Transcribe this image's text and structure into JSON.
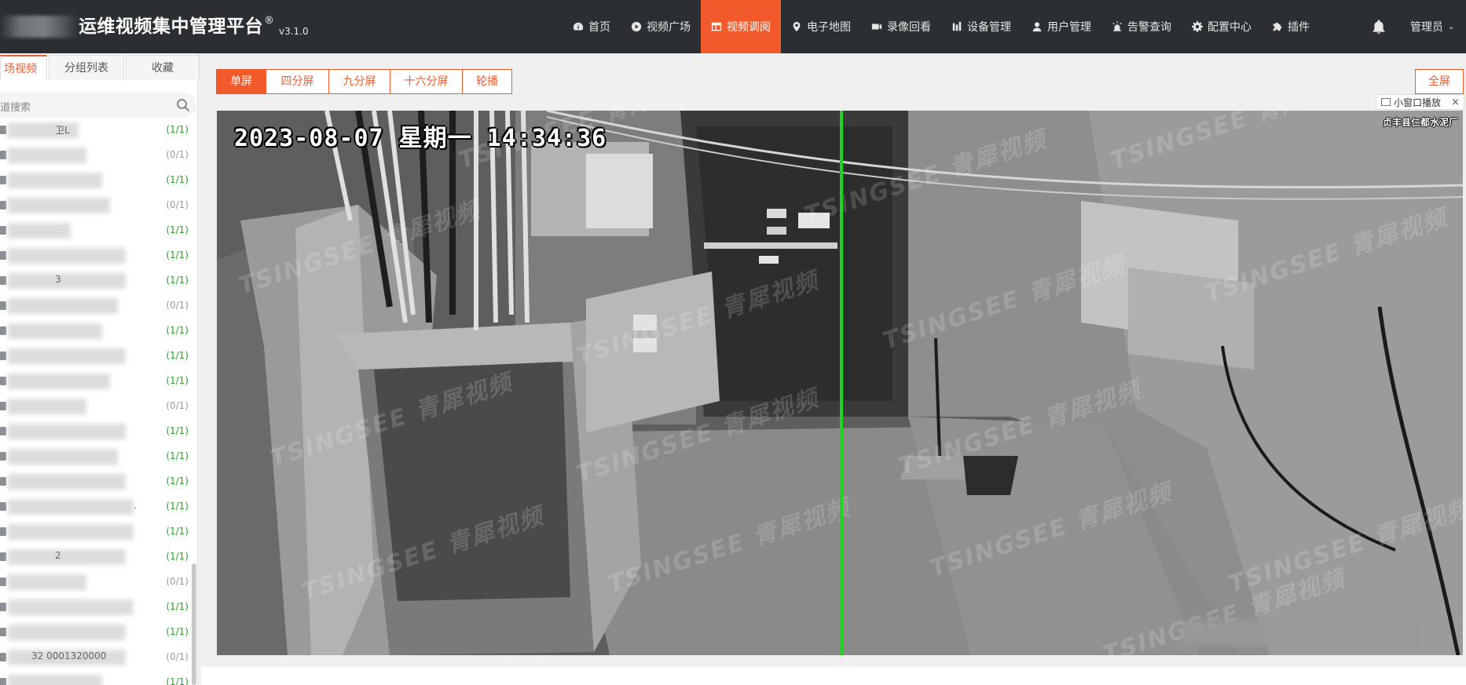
{
  "header": {
    "title": "运维视频集中管理平台",
    "registered": "®",
    "version": "v3.1.0",
    "nav": [
      {
        "label": "首页",
        "icon": "dashboard-icon",
        "active": false
      },
      {
        "label": "视频广场",
        "icon": "play-circle-icon",
        "active": false
      },
      {
        "label": "视频调阅",
        "icon": "grid-table-icon",
        "active": true
      },
      {
        "label": "电子地图",
        "icon": "map-pin-icon",
        "active": false
      },
      {
        "label": "录像回看",
        "icon": "video-camera-icon",
        "active": false
      },
      {
        "label": "设备管理",
        "icon": "device-bars-icon",
        "active": false
      },
      {
        "label": "用户管理",
        "icon": "user-icon",
        "active": false
      },
      {
        "label": "告警查询",
        "icon": "alarm-icon",
        "active": false
      },
      {
        "label": "配置中心",
        "icon": "gear-icon",
        "active": false
      },
      {
        "label": "插件",
        "icon": "puzzle-icon",
        "active": false
      }
    ],
    "notification_icon": "bell-icon",
    "user_label": "管理员"
  },
  "sidebar": {
    "tabs": [
      {
        "label": "场视频",
        "active": true
      },
      {
        "label": "分组列表",
        "active": false
      },
      {
        "label": "收藏",
        "active": false
      }
    ],
    "search_placeholder": "道搜索",
    "items": [
      {
        "fragment": "卫L",
        "count": "(1/1)",
        "online": true
      },
      {
        "fragment": "",
        "count": "(0/1)",
        "online": false
      },
      {
        "fragment": "",
        "count": "(1/1)",
        "online": true
      },
      {
        "fragment": "",
        "count": "(0/1)",
        "online": false
      },
      {
        "fragment": "",
        "count": "(1/1)",
        "online": true
      },
      {
        "fragment": "",
        "count": "(1/1)",
        "online": true
      },
      {
        "fragment": "3",
        "count": "(1/1)",
        "online": true
      },
      {
        "fragment": "",
        "count": "(0/1)",
        "online": false
      },
      {
        "fragment": "",
        "count": "(1/1)",
        "online": true
      },
      {
        "fragment": "",
        "count": "(1/1)",
        "online": true
      },
      {
        "fragment": "",
        "count": "(1/1)",
        "online": true
      },
      {
        "fragment": "",
        "count": "(0/1)",
        "online": false
      },
      {
        "fragment": "",
        "count": "(1/1)",
        "online": true
      },
      {
        "fragment": "",
        "count": "(1/1)",
        "online": true
      },
      {
        "fragment": "",
        "count": "(1/1)",
        "online": true
      },
      {
        "fragment": ".",
        "count": "(1/1)",
        "online": true
      },
      {
        "fragment": "",
        "count": "(1/1)",
        "online": true
      },
      {
        "fragment": "2",
        "count": "(1/1)",
        "online": true
      },
      {
        "fragment": "",
        "count": "(0/1)",
        "online": false
      },
      {
        "fragment": "",
        "count": "(1/1)",
        "online": true
      },
      {
        "fragment": "",
        "count": "(1/1)",
        "online": true
      },
      {
        "fragment": "32  0001320000",
        "count": "(0/1)",
        "online": false
      },
      {
        "fragment": "",
        "count": "(1/1)",
        "online": true
      }
    ]
  },
  "toolbar": {
    "layouts": [
      {
        "label": "单屏",
        "active": true
      },
      {
        "label": "四分屏",
        "active": false
      },
      {
        "label": "九分屏",
        "active": false
      },
      {
        "label": "十六分屏",
        "active": false
      },
      {
        "label": "轮播",
        "active": false
      }
    ],
    "fullscreen_label": "全屏",
    "mini_window_label": "小窗口播放",
    "mini_close": "×"
  },
  "video": {
    "timestamp": "2023-08-07 星期一 14:34:36",
    "site_label": "贞丰县仁都水泥厂",
    "watermark": "TSINGSEE 青犀视频"
  },
  "colors": {
    "accent": "#f25a2b",
    "online": "#2aa52a",
    "offline": "#999999",
    "topbar": "#2b2f33"
  }
}
